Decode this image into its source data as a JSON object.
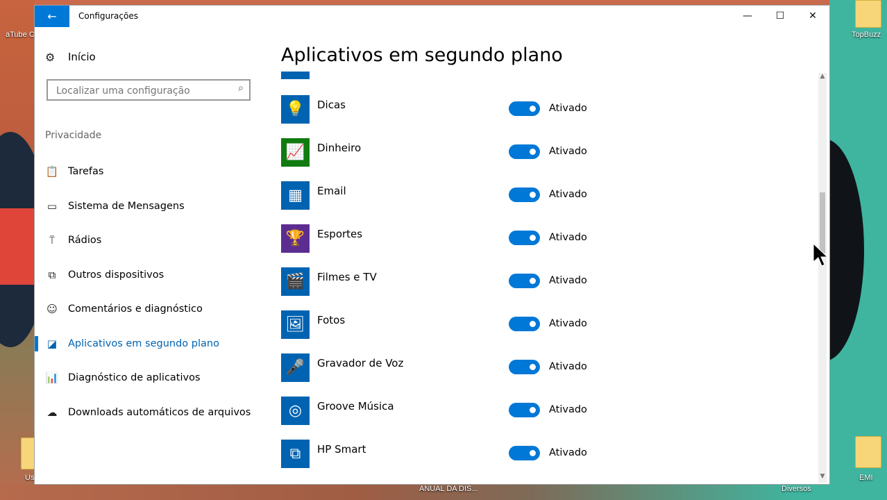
{
  "window": {
    "title": "Configurações",
    "controls": [
      "minimize",
      "maximize",
      "close"
    ]
  },
  "sidebar": {
    "home_label": "Início",
    "search_placeholder": "Localizar uma configuração",
    "section_title": "Privacidade",
    "items": [
      {
        "label": "Tarefas",
        "icon": "clipboard-icon"
      },
      {
        "label": "Sistema de Mensagens",
        "icon": "message-icon"
      },
      {
        "label": "Rádios",
        "icon": "radio-tower-icon"
      },
      {
        "label": "Outros dispositivos",
        "icon": "devices-icon"
      },
      {
        "label": "Comentários e diagnóstico",
        "icon": "feedback-icon"
      },
      {
        "label": "Aplicativos em segundo plano",
        "icon": "background-apps-icon",
        "active": true
      },
      {
        "label": "Diagnóstico de aplicativos",
        "icon": "chart-icon"
      },
      {
        "label": "Downloads automáticos de arquivos",
        "icon": "cloud-icon"
      }
    ]
  },
  "main": {
    "title": "Aplicativos em segundo plano",
    "apps": [
      {
        "name": "Dicas",
        "state": "Ativado",
        "icon": "lightbulb-icon"
      },
      {
        "name": "Dinheiro",
        "state": "Ativado",
        "icon": "money-chart-icon"
      },
      {
        "name": "Email",
        "state": "Ativado",
        "icon": "calendar-mail-icon"
      },
      {
        "name": "Esportes",
        "state": "Ativado",
        "icon": "trophy-icon"
      },
      {
        "name": "Filmes e TV",
        "state": "Ativado",
        "icon": "clapperboard-icon"
      },
      {
        "name": "Fotos",
        "state": "Ativado",
        "icon": "photo-icon"
      },
      {
        "name": "Gravador de Voz",
        "state": "Ativado",
        "icon": "microphone-icon"
      },
      {
        "name": "Groove Música",
        "state": "Ativado",
        "icon": "music-disc-icon"
      },
      {
        "name": "HP Smart",
        "state": "Ativado",
        "icon": "printer-devices-icon"
      }
    ]
  },
  "desktop": {
    "labels": [
      "aTube C",
      "TopBuzz",
      "Us",
      "ANUAL DA DIS...",
      "Diversos",
      "EMI"
    ]
  },
  "colors": {
    "accent": "#0078d7",
    "active_text": "#0063b1"
  }
}
